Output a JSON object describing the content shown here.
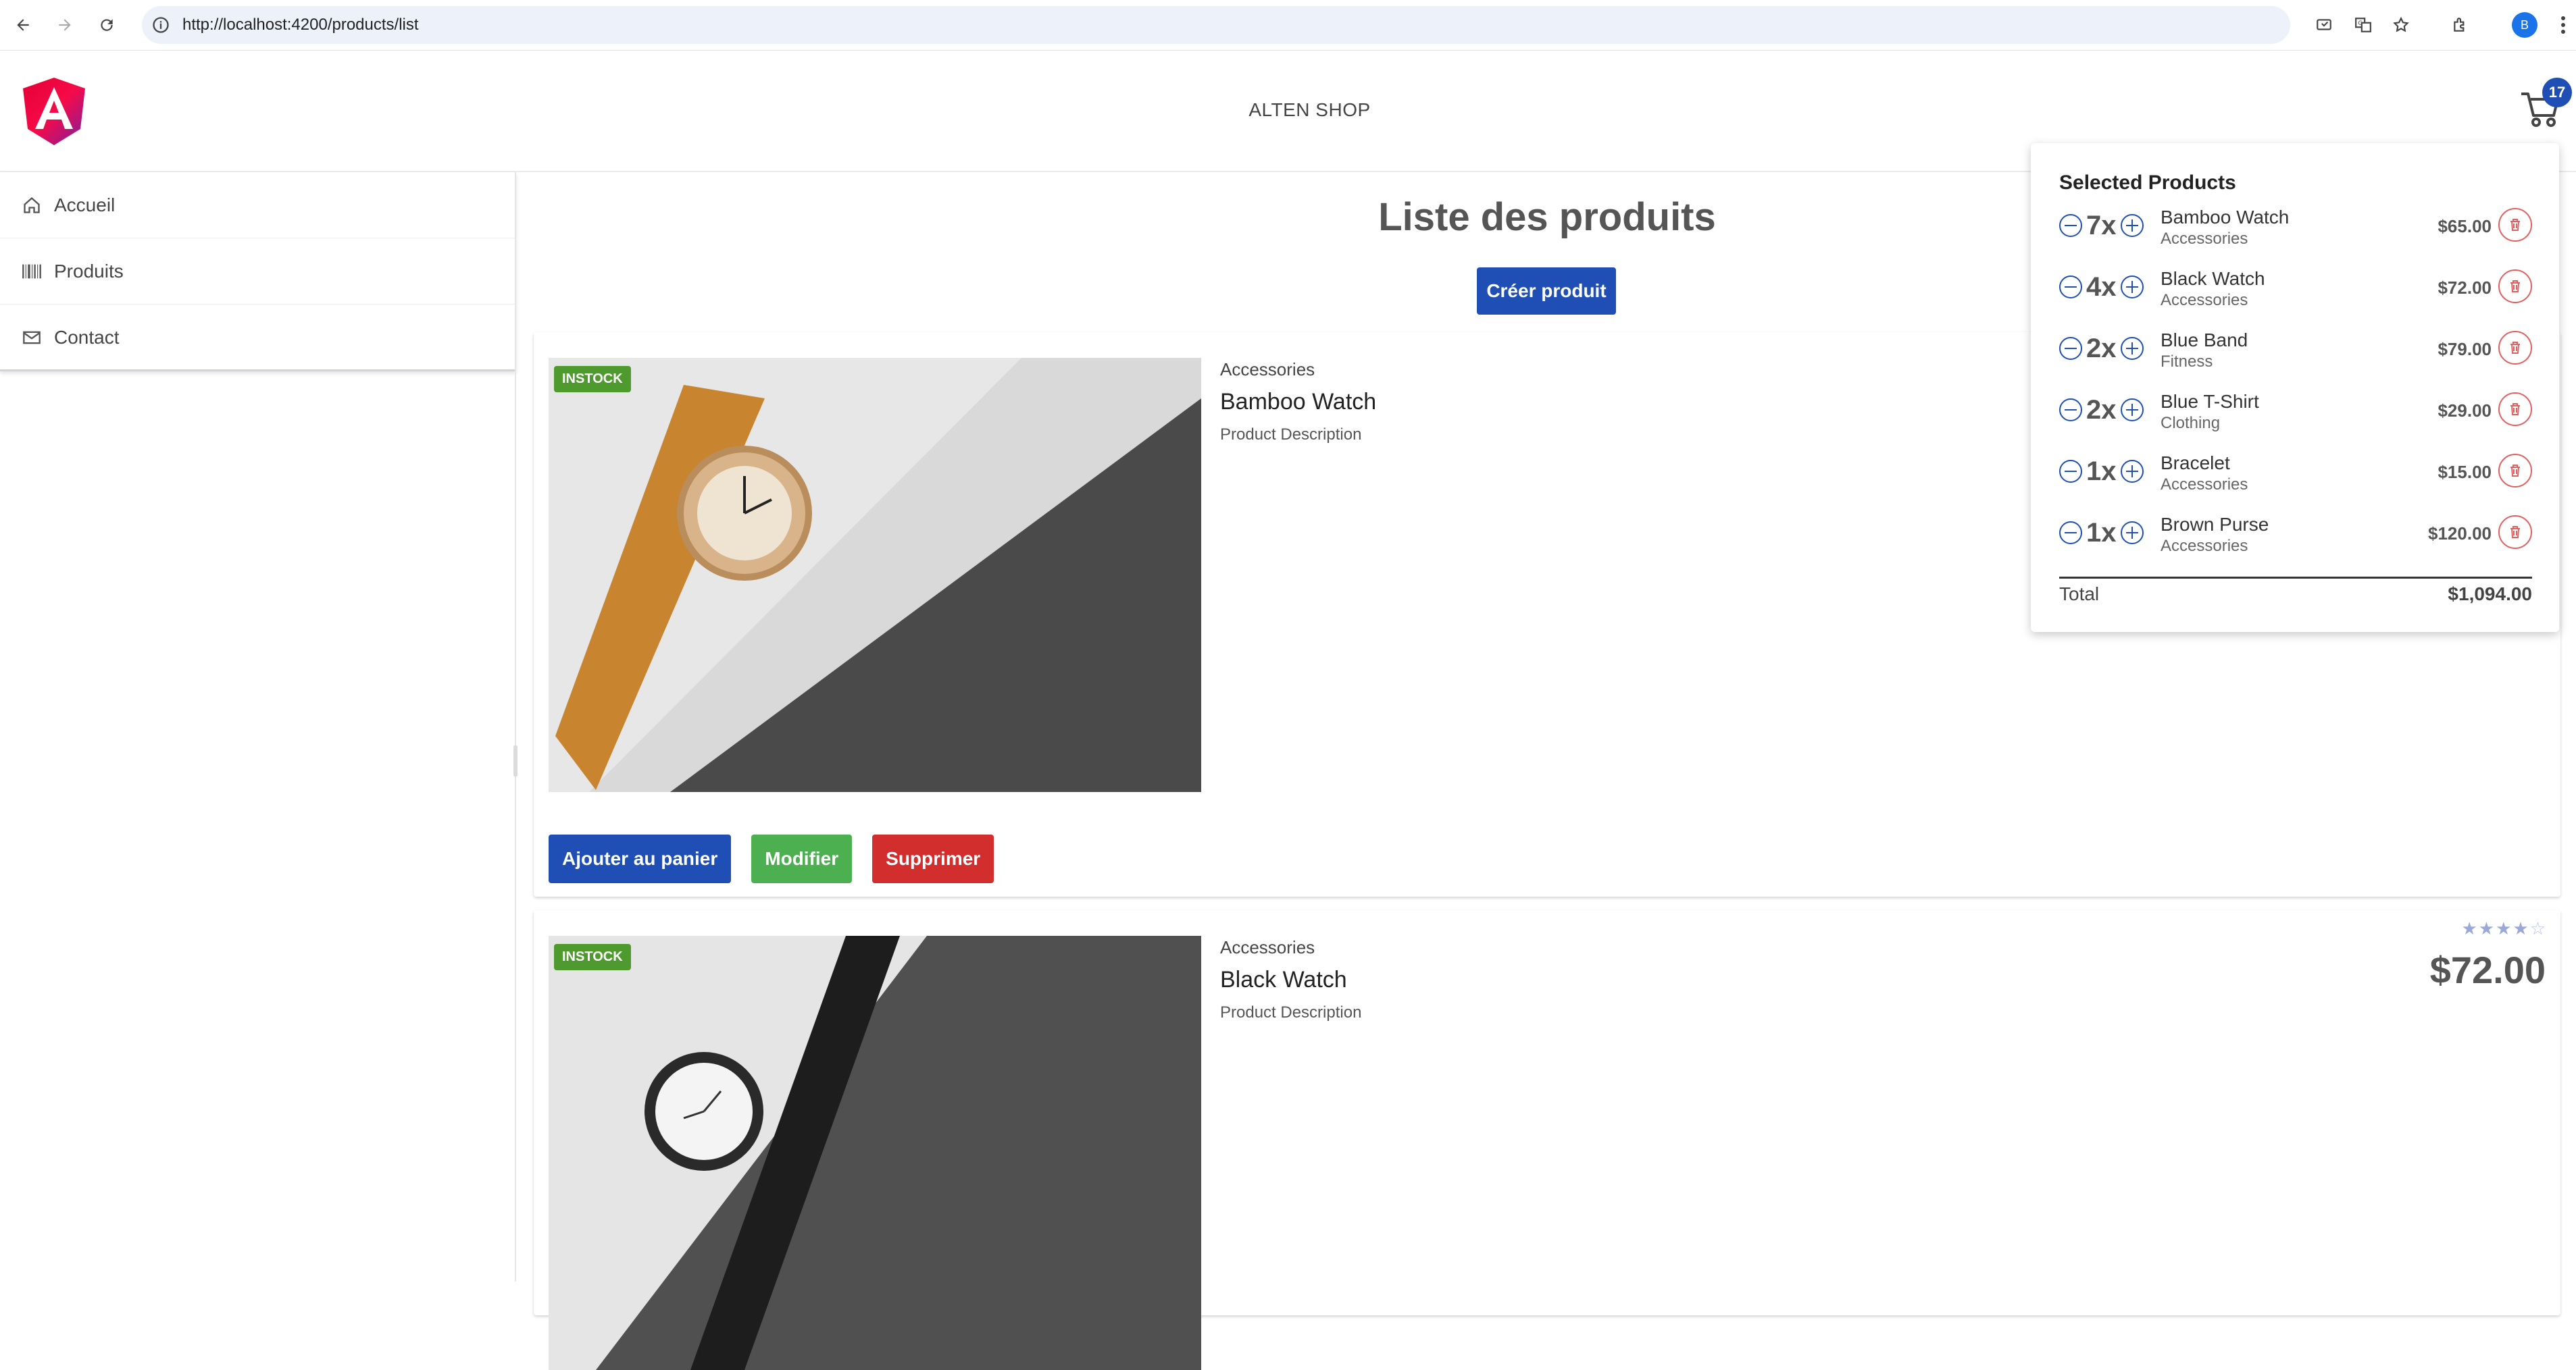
{
  "browser": {
    "url": "http://localhost:4200/products/list",
    "profile_initial": "B"
  },
  "header": {
    "shop_title": "ALTEN SHOP",
    "cart_count": "17",
    "logo_icon": "angular-logo-icon",
    "logo_colors": [
      "#e40035",
      "#f60a48",
      "#c2185b",
      "#7b1fa2"
    ]
  },
  "sidebar": {
    "items": [
      {
        "label": "Accueil",
        "icon": "home-icon"
      },
      {
        "label": "Produits",
        "icon": "barcode-icon"
      },
      {
        "label": "Contact",
        "icon": "envelope-icon"
      }
    ]
  },
  "main": {
    "title": "Liste des produits",
    "create_label": "Créer produit",
    "products": [
      {
        "status": "INSTOCK",
        "category": "Accessories",
        "name": "Bamboo Watch",
        "description": "Product Description",
        "actions": {
          "add": "Ajouter au panier",
          "edit": "Modifier",
          "delete": "Supprimer"
        }
      },
      {
        "status": "INSTOCK",
        "category": "Accessories",
        "name": "Black Watch",
        "description": "Product Description",
        "price": "$72.00",
        "rating": 4
      }
    ]
  },
  "cart": {
    "title": "Selected Products",
    "items": [
      {
        "qty": "7x",
        "name": "Bamboo Watch",
        "category": "Accessories",
        "price": "$65.00"
      },
      {
        "qty": "4x",
        "name": "Black Watch",
        "category": "Accessories",
        "price": "$72.00"
      },
      {
        "qty": "2x",
        "name": "Blue Band",
        "category": "Fitness",
        "price": "$79.00"
      },
      {
        "qty": "2x",
        "name": "Blue T-Shirt",
        "category": "Clothing",
        "price": "$29.00"
      },
      {
        "qty": "1x",
        "name": "Bracelet",
        "category": "Accessories",
        "price": "$15.00"
      },
      {
        "qty": "1x",
        "name": "Brown Purse",
        "category": "Accessories",
        "price": "$120.00"
      }
    ],
    "total_label": "Total",
    "total_value": "$1,094.00"
  },
  "colors": {
    "primary": "#1f4fb5",
    "success": "#4caf50",
    "danger": "#d22e2e",
    "instock": "#4f9a2e"
  }
}
